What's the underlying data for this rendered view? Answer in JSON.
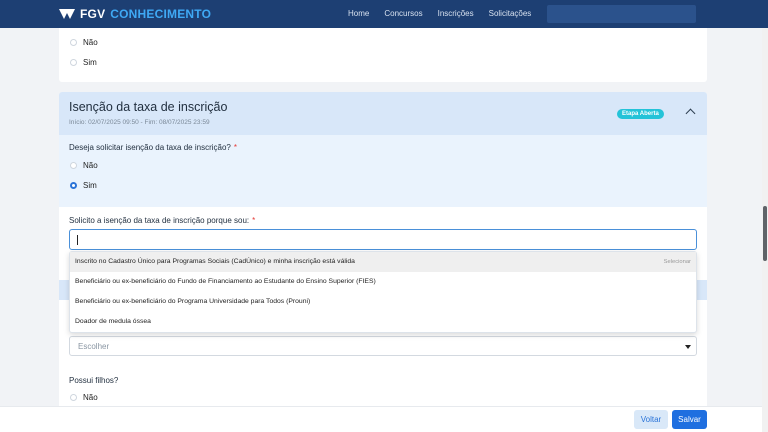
{
  "header": {
    "logo_fgv": "FGV",
    "logo_conhecimento": "CONHECIMENTO",
    "nav": [
      "Home",
      "Concursos",
      "Inscrições",
      "Solicitações"
    ]
  },
  "top_card": {
    "options": [
      "Não",
      "Sim"
    ]
  },
  "isencao": {
    "title": "Isenção da taxa de inscrição",
    "subtitle": "Início: 02/07/2025 09:50 - Fim: 08/07/2025 23:59",
    "badge": "Etapa Aberta",
    "q1_label": "Deseja solicitar isenção da taxa de inscrição?",
    "q1_required": "*",
    "q1_options": [
      "Não",
      "Sim"
    ],
    "q1_selected": "Sim",
    "q2_label": "Solicito a isenção da taxa de inscrição porque sou:",
    "q2_required": "*"
  },
  "dropdown": {
    "options": [
      "Inscrito no Cadastro Único para Programas Sociais (CadÚnico) e minha inscrição está válida",
      "Beneficiário ou ex-beneficiário do Fundo de Financiamento ao Estudante do Ensino Superior (FIES)",
      "Beneficiário ou ex-beneficiário do Programa Universidade para Todos (Prouni)",
      "Doador de medula óssea"
    ],
    "hint": "Selecionar"
  },
  "lower": {
    "select_placeholder": "Escolher",
    "children_label": "Possui filhos?",
    "children_option": "Não"
  },
  "footer": {
    "back_label": "Voltar",
    "save_label": "Salvar"
  },
  "colors": {
    "header_bg": "#1d3f73",
    "accent": "#1f6fe0",
    "badge": "#24c3d8",
    "required": "#e53935"
  }
}
